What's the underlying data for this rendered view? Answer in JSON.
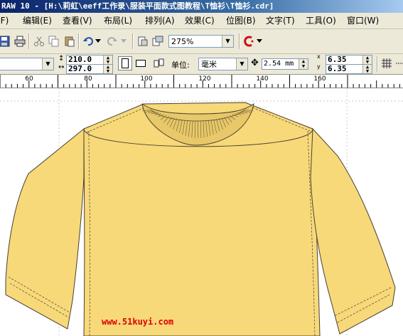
{
  "window": {
    "title": "RAW 10 - [H:\\莉虹\\eeff工作录\\服装平面款式图教程\\T恤衫\\T恤衫.cdr]"
  },
  "menu": {
    "items": [
      {
        "label": "(F)"
      },
      {
        "label": "编辑(E)"
      },
      {
        "label": "查看(V)"
      },
      {
        "label": "布局(L)"
      },
      {
        "label": "排列(A)"
      },
      {
        "label": "效果(C)"
      },
      {
        "label": "位图(B)"
      },
      {
        "label": "文字(T)"
      },
      {
        "label": "工具(O)"
      },
      {
        "label": "窗口(W)"
      }
    ]
  },
  "toolbar": {
    "zoom_value": "275%",
    "icons": [
      "save-icon",
      "print-icon",
      "cut-icon",
      "copy-icon",
      "paste-icon",
      "undo-icon",
      "redo-icon",
      "import-icon",
      "export-icon",
      "corel-launch-icon"
    ]
  },
  "property_bar": {
    "paper_size": "",
    "width": "210.0",
    "height": "297.0",
    "units_label": "单位:",
    "units_value": "毫米",
    "nudge": "2.54 mm",
    "dup_x": "6.35",
    "dup_y": "6.35",
    "dup_x_label": "x",
    "dup_y_label": "y"
  },
  "ruler": {
    "labels": [
      "60",
      "80",
      "100",
      "120",
      "140",
      "160"
    ]
  },
  "canvas": {
    "garment_color": "#f7d97a",
    "outline_color": "#4a4030"
  },
  "watermark": "www.51kuyi.com"
}
